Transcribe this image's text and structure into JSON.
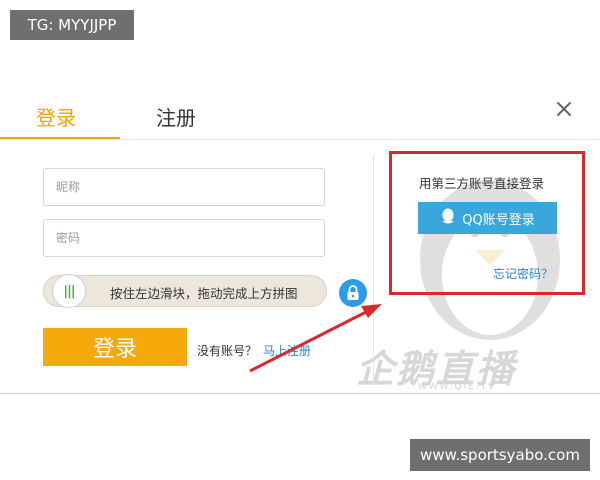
{
  "overlay": {
    "tg_text": "TG: MYYJJPP",
    "site_url": "www.sportsyabo.com"
  },
  "tabs": {
    "login_label": "登录",
    "register_label": "注册"
  },
  "form": {
    "nickname_placeholder": "昵称",
    "password_placeholder": "密码",
    "slider_text": "按住左边滑块，拖动完成上方拼图",
    "login_button": "登录",
    "no_account_text": "没有账号？",
    "register_link": "马上注册"
  },
  "third_party": {
    "label": "用第三方账号直接登录",
    "qq_button": "QQ账号登录",
    "forgot_password": "忘记密码？"
  },
  "watermark": {
    "text": "企鹅直播",
    "url": "WWW.QIE.TV"
  },
  "colors": {
    "accent": "#f0a30a",
    "qq_blue": "#3aa7dc",
    "highlight_red": "#d72a2a",
    "link_blue": "#2a82d2"
  },
  "icons": [
    "close-icon",
    "slider-grip-icon",
    "lock-icon",
    "qq-penguin-icon",
    "red-arrow"
  ]
}
